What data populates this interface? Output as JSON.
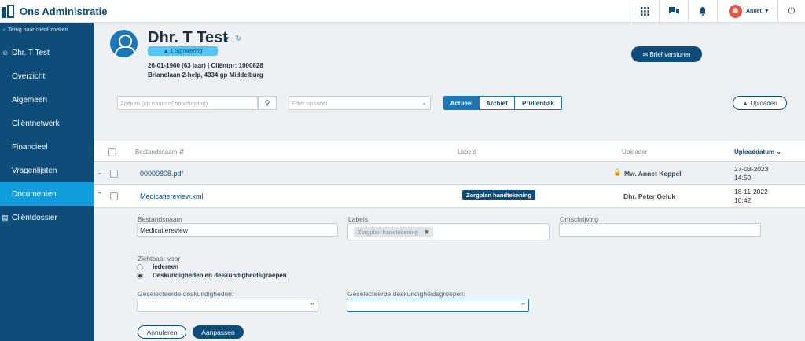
{
  "app": {
    "title": "Ons Administratie"
  },
  "topbar": {
    "icons": [
      "apps-grid-icon",
      "chat-icon",
      "bell-icon"
    ],
    "user_name": "Annet",
    "power_icon": "power-icon"
  },
  "sidebar": {
    "back_label": "Terug naar cliënt zoeken",
    "client_label": "Dhr. T Test",
    "items": [
      {
        "label": "Overzicht"
      },
      {
        "label": "Algemeen"
      },
      {
        "label": "Cliëntnetwerk"
      },
      {
        "label": "Financieel"
      },
      {
        "label": "Vragenlijsten"
      },
      {
        "label": "Documenten",
        "active": true
      },
      {
        "label": "Cliëntdossier"
      }
    ]
  },
  "patient": {
    "name": "Dhr. T Test",
    "signal": "1 Signalering",
    "dob_line": "26-01-1960 (63 jaar) | Cliëntnr: 1000628",
    "address": "Briandlaan 2-help, 4334 gp Middelburg"
  },
  "actions": {
    "brief_label": "Brief versturen",
    "upload_label": "Uploaden"
  },
  "filters": {
    "search_placeholder": "Zoeken (op naam of beschrijving)",
    "label_placeholder": "Filter op label",
    "tabs": [
      "Actueel",
      "Archief",
      "Prullenbak"
    ],
    "active_tab": "Actueel"
  },
  "table": {
    "headers": {
      "name": "Bestandsnaam",
      "labels": "Labels",
      "uploader": "Uploader",
      "date": "Uploaddatum"
    },
    "rows": [
      {
        "name": "00000808.pdf",
        "label": "",
        "uploader": "Mw. Annet Keppel",
        "locked": true,
        "date": "27-03-2023",
        "time": "14:50"
      },
      {
        "name": "Medicatiereview.xml",
        "label": "Zorgplan handtekening",
        "uploader": "Dhr. Peter Geluk",
        "locked": false,
        "date": "18-11-2022",
        "time": "10:42"
      }
    ]
  },
  "form": {
    "name_label": "Bestandsnaam",
    "name_value": "Medicatiereview",
    "labels_label": "Labels",
    "tag": "Zorgplan handtekening",
    "description_label": "Omschrijving",
    "visible_label": "Zichtbaar voor",
    "options": [
      "Iedereen",
      "Deskundigheden en deskundigheidsgroepen"
    ],
    "selected_option": "Deskundigheden en deskundigheidsgroepen",
    "expertise_label": "Geselecteerde deskundigheden:",
    "groups_label": "Geselecteerde deskundigheidsgroepen:",
    "cancel_label": "Annuleren",
    "save_label": "Aanpassen"
  }
}
